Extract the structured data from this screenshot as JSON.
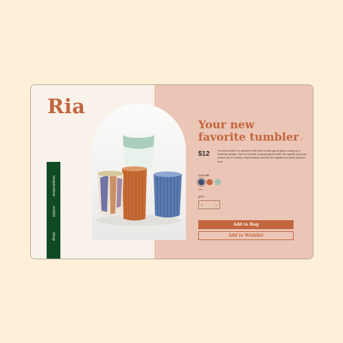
{
  "brand": {
    "name": "Ria"
  },
  "nav": {
    "items": [
      "inspiration",
      "outlet",
      "shop"
    ]
  },
  "product": {
    "headline_line1": "Your new",
    "headline_line2": "favorite tumbler",
    "price": "$12",
    "description": "Ceramic tumbler is a speckled finish with overlaid glazed glass running up a bohemian design. Each formed with a special glazed finish, this special piece you receive will be a totally unique treasure and will also slightly from what's pictured here.",
    "color_label": "COLOR",
    "selected_color_name": "navy",
    "swatches": [
      {
        "name": "navy",
        "color": "#3d4e6e"
      },
      {
        "name": "terracotta",
        "color": "#c2663f"
      },
      {
        "name": "sage",
        "color": "#9ec1b3"
      }
    ],
    "qty_label": "QTY",
    "qty_value": "1",
    "add_to_bag": "Add to Bag",
    "add_to_wishlist": "Add to Wishlist"
  },
  "colors": {
    "background": "#fdefd8",
    "accent": "#c2663f",
    "nav_bg": "#0f4a25",
    "panel_pink": "#ebc5b5",
    "panel_cream": "#f8f2ea"
  },
  "icons": {
    "qty_dropdown": "chevron-down-icon"
  }
}
